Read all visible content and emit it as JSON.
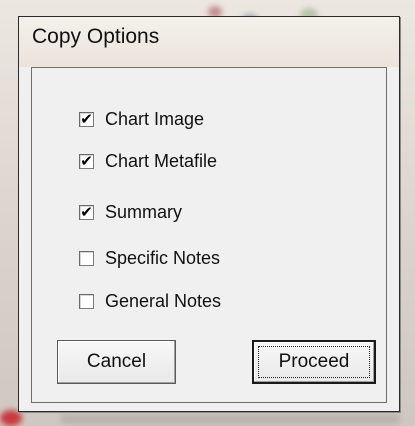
{
  "dialog": {
    "title": "Copy Options",
    "options": [
      {
        "label": "Chart Image",
        "checked": true
      },
      {
        "label": "Chart Metafile",
        "checked": true
      },
      {
        "label": "Summary",
        "checked": true
      },
      {
        "label": "Specific Notes",
        "checked": false
      },
      {
        "label": "General Notes",
        "checked": false
      }
    ],
    "buttons": {
      "cancel_label": "Cancel",
      "proceed_label": "Proceed"
    },
    "check_glyph": "✔"
  }
}
